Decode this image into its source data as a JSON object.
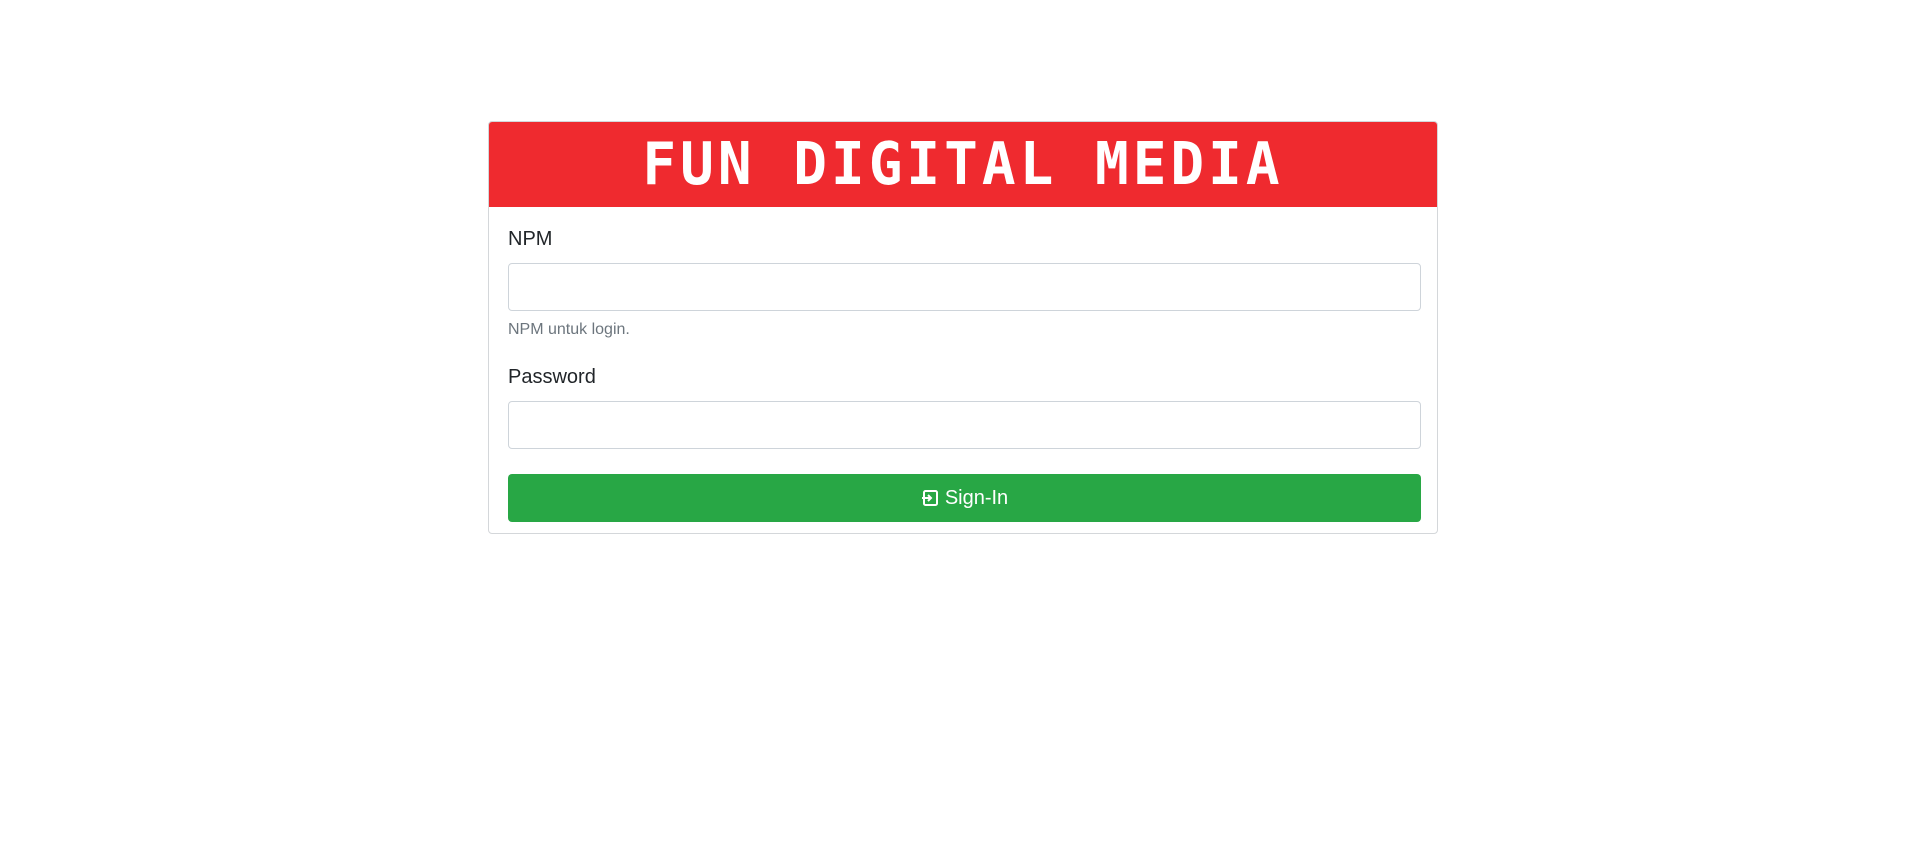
{
  "header": {
    "logo_text": "FUN DIGITAL MEDIA",
    "background_color": "#ef2a2f"
  },
  "form": {
    "npm": {
      "label": "NPM",
      "value": "",
      "help": "NPM untuk login."
    },
    "password": {
      "label": "Password",
      "value": ""
    },
    "submit": {
      "icon": "sign-in-icon",
      "label": "Sign-In",
      "color": "#28a745"
    }
  }
}
